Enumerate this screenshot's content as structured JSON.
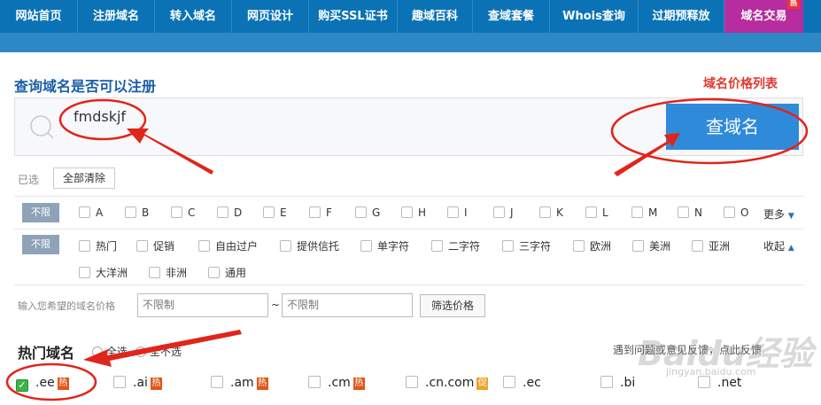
{
  "nav": {
    "items": [
      "网站首页",
      "注册域名",
      "转入域名",
      "网页设计",
      "购买SSL证书",
      "趣域百科",
      "查域套餐",
      "Whois查询",
      "过期预释放",
      "域名交易"
    ],
    "active_index": 9,
    "hot_tag": "热"
  },
  "search": {
    "title": "查询域名是否可以注册",
    "price_list_link": "域名价格列表",
    "value": "fmdskjf",
    "button": "查域名"
  },
  "selected": {
    "label": "已选",
    "clear": "全部清除"
  },
  "letters": {
    "tag": "不限",
    "options": [
      "A",
      "B",
      "C",
      "D",
      "E",
      "F",
      "G",
      "H",
      "I",
      "J",
      "K",
      "L",
      "M",
      "N",
      "O"
    ],
    "more": "更多"
  },
  "categories": {
    "tag": "不限",
    "row1": [
      "热门",
      "促销",
      "自由过户",
      "提供信托",
      "单字符",
      "二字符",
      "三字符",
      "欧洲",
      "美洲",
      "亚洲"
    ],
    "row2": [
      "大洋洲",
      "非洲",
      "通用"
    ],
    "collapse": "收起"
  },
  "price": {
    "label": "输入您希望的域名价格",
    "min": "不限制",
    "max": "不限制",
    "separator": "~",
    "button": "筛选价格"
  },
  "hot": {
    "title": "热门域名",
    "select_all": "全选",
    "select_none": "全不选",
    "feedback": "遇到问题或意见反馈，点此反馈",
    "domains": [
      {
        "name": ".ee",
        "checked": true,
        "badge": "热"
      },
      {
        "name": ".ai",
        "checked": false,
        "badge": "热"
      },
      {
        "name": ".am",
        "checked": false,
        "badge": "热"
      },
      {
        "name": ".cm",
        "checked": false,
        "badge": "热"
      },
      {
        "name": ".cn.com",
        "checked": false,
        "badge": "促"
      },
      {
        "name": ".ec",
        "checked": false,
        "badge": ""
      },
      {
        "name": ".bi",
        "checked": false,
        "badge": ""
      },
      {
        "name": ".net",
        "checked": false,
        "badge": ""
      }
    ]
  },
  "watermark": {
    "text": "Baidu经验",
    "sub": "jingyan.baidu.com"
  },
  "colors": {
    "nav": "#0b73b5",
    "nav_active": "#b72c9f",
    "button": "#2f8ad9",
    "annotation": "#e0251b",
    "title": "#1a5ea8"
  }
}
